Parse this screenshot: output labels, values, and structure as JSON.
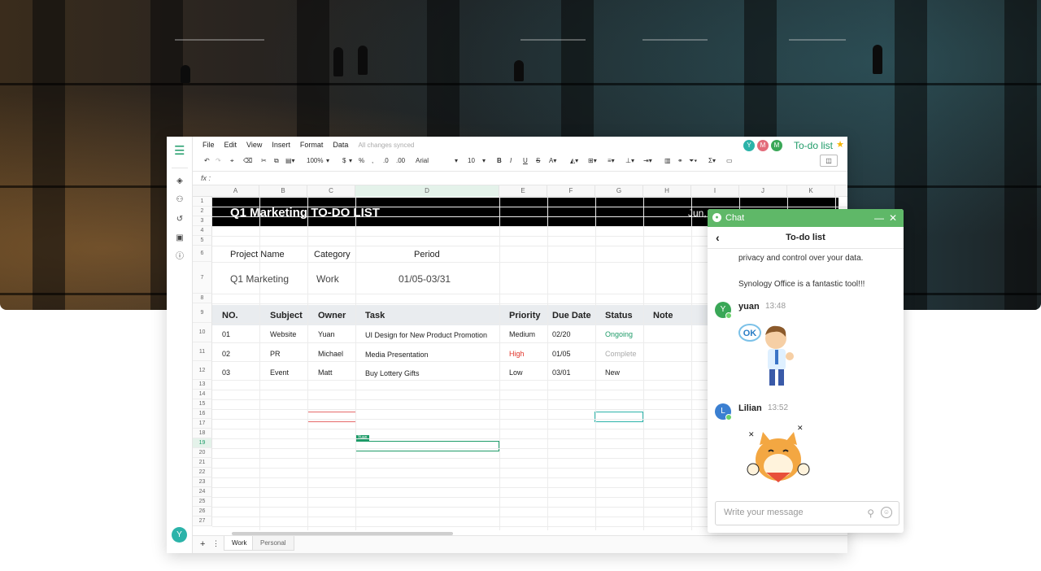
{
  "menu": [
    "File",
    "Edit",
    "View",
    "Insert",
    "Format",
    "Data"
  ],
  "sync_status": "All changes synced",
  "collaborators": [
    {
      "initial": "Y",
      "color": "#2bb3a9"
    },
    {
      "initial": "M",
      "color": "#e36b7a"
    },
    {
      "initial": "M",
      "color": "#3aa757"
    }
  ],
  "doc_title": "To-do list",
  "toolbar": {
    "zoom": "100%",
    "currency": "$",
    "percent": "%",
    "decimal_less": ".0",
    "decimal_more": ".00",
    "font": "Arial",
    "font_size": "10",
    "bold": "B",
    "italic": "I",
    "underline": "U",
    "strike": "S"
  },
  "formula_label": "fx :",
  "columns": [
    "A",
    "B",
    "C",
    "D",
    "E",
    "F",
    "G",
    "H",
    "I",
    "J",
    "K"
  ],
  "rows": [
    "1",
    "2",
    "3",
    "4",
    "5",
    "6",
    "7",
    "8",
    "9",
    "10",
    "11",
    "12",
    "13",
    "14",
    "15",
    "16",
    "17",
    "18",
    "19",
    "20",
    "21",
    "22",
    "23",
    "24",
    "25",
    "26",
    "27"
  ],
  "sheet": {
    "title": "Q1 Marketing TO-DO LIST",
    "date": "Jun,",
    "info_headers": [
      "Project Name",
      "Category",
      "Period"
    ],
    "info_values": [
      "Q1 Marketing",
      "Work",
      "01/05-03/31"
    ],
    "table_headers": [
      "NO.",
      "Subject",
      "Owner",
      "Task",
      "Priority",
      "Due Date",
      "Status",
      "Note"
    ],
    "table_rows": [
      {
        "no": "01",
        "subject": "Website",
        "owner": "Yuan",
        "task": "UI Design for New Product Promotion",
        "priority": "Medium",
        "due": "02/20",
        "status": "Ongoing"
      },
      {
        "no": "02",
        "subject": "PR",
        "owner": "Michael",
        "task": "Media Presentation",
        "priority": "High",
        "due": "01/05",
        "status": "Complete"
      },
      {
        "no": "03",
        "subject": "Event",
        "owner": "Matt",
        "task": "Buy Lottery Gifts",
        "priority": "Low",
        "due": "03/01",
        "status": "New"
      }
    ]
  },
  "cursor_tag": "Yuan",
  "sheet_tabs": [
    "Work",
    "Personal"
  ],
  "user_avatar": "Y",
  "chat": {
    "title": "Chat",
    "thread_title": "To-do list",
    "messages_text": [
      "privacy and control over your data.",
      "Synology Office is a fantastic tool!!!"
    ],
    "messages": [
      {
        "initial": "Y",
        "name": "yuan",
        "time": "13:48",
        "color": "#3aa757",
        "sticker_text": "OK"
      },
      {
        "initial": "L",
        "name": "Lilian",
        "time": "13:52",
        "color": "#3b7fd1"
      }
    ],
    "input_placeholder": "Write your message"
  }
}
